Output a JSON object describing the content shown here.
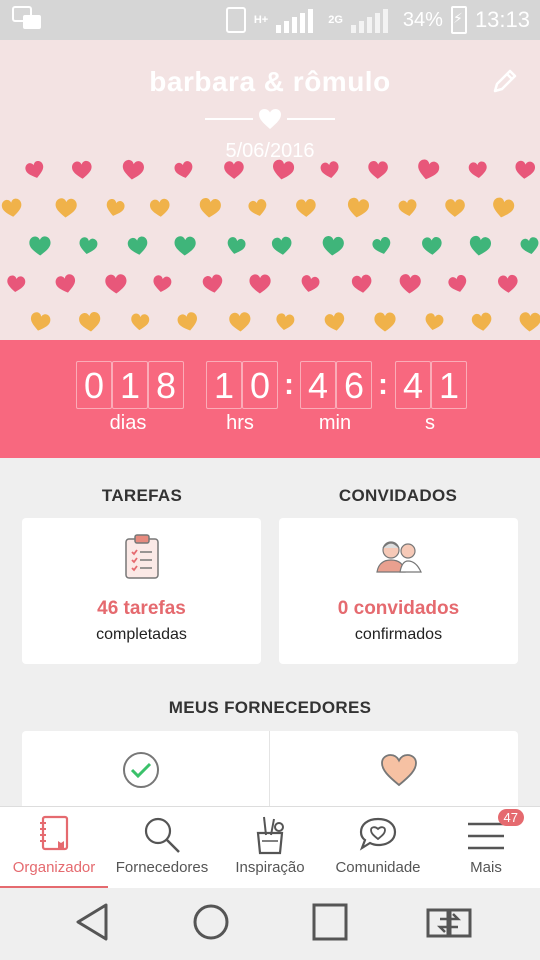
{
  "status_bar": {
    "battery": "34%",
    "time": "13:13",
    "network": "H+",
    "network2": "2G"
  },
  "header": {
    "couple_name": "barbara & rômulo",
    "date": "5/06/2016"
  },
  "countdown": {
    "days_digits": [
      "0",
      "1",
      "8"
    ],
    "hours_digits": [
      "1",
      "0"
    ],
    "min_digits": [
      "4",
      "6"
    ],
    "sec_digits": [
      "4",
      "1"
    ],
    "units": {
      "days": "dias",
      "hours": "hrs",
      "min": "min",
      "sec": "s"
    }
  },
  "sections": {
    "tasks": {
      "title": "TAREFAS",
      "count": "46 tarefas",
      "status": "completadas"
    },
    "guests": {
      "title": "CONVIDADOS",
      "count": "0 convidados",
      "status": "confirmados"
    },
    "vendors": {
      "title": "MEUS FORNECEDORES"
    }
  },
  "bottom_nav": {
    "items": [
      {
        "label": "Organizador",
        "icon": "notebook-icon"
      },
      {
        "label": "Fornecedores",
        "icon": "search-icon"
      },
      {
        "label": "Inspiração",
        "icon": "pencil-cup-icon"
      },
      {
        "label": "Comunidade",
        "icon": "chat-heart-icon"
      },
      {
        "label": "Mais",
        "icon": "menu-icon"
      }
    ],
    "badge": "47",
    "active_index": 0
  },
  "colors": {
    "accent": "#f8687f",
    "accent_text": "#e56a6f",
    "header_bg": "#f3e3e3"
  }
}
